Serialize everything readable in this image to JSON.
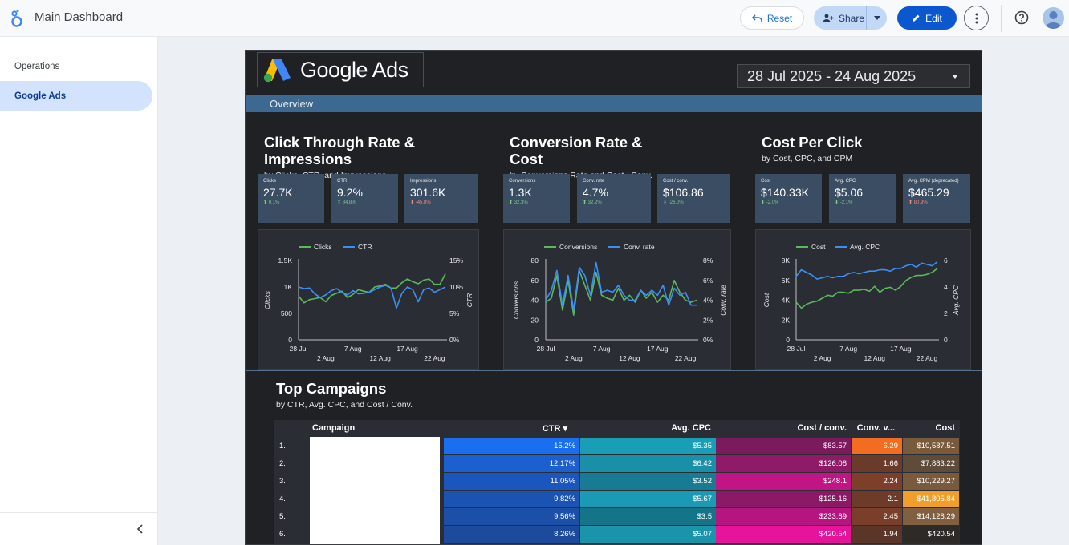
{
  "topbar": {
    "title": "Main Dashboard",
    "reset_label": "Reset",
    "share_label": "Share",
    "edit_label": "Edit"
  },
  "sidebar": {
    "items": [
      {
        "label": "Operations"
      },
      {
        "label": "Google Ads"
      }
    ],
    "active": "Google Ads"
  },
  "report": {
    "logo_text": "Google Ads",
    "date_range": "28 Jul 2025 - 24 Aug 2025",
    "overview_label": "Overview",
    "sections": [
      {
        "title_line1": "Click Through Rate &",
        "title_line2": "Impressions",
        "subtitle": "by Clicks, CTR, and Impressions"
      },
      {
        "title_line1": "Conversion Rate &",
        "title_line2": "Cost",
        "subtitle": "by Conversions Rate and Cost / Conv."
      },
      {
        "title_line1": "Cost Per Click",
        "title_line2": "",
        "subtitle": "by Cost, CPC, and CPM"
      }
    ],
    "kpis": [
      {
        "label": "Clicks",
        "value": "27.7K",
        "change": "⬆ 0.1%",
        "dir": "up"
      },
      {
        "label": "CTR",
        "value": "9.2%",
        "change": "⬆ 84.8%",
        "dir": "up"
      },
      {
        "label": "Impressions",
        "value": "301.6K",
        "change": "⬇ -45.8%",
        "dir": "down"
      },
      {
        "label": "Conversions",
        "value": "1.3K",
        "change": "⬆ 32.3%",
        "dir": "up"
      },
      {
        "label": "Conv. rate",
        "value": "4.7%",
        "change": "⬆ 32.2%",
        "dir": "up"
      },
      {
        "label": "Cost / conv.",
        "value": "$106.86",
        "change": "⬇ -26.0%",
        "dir": "up"
      },
      {
        "label": "Cost",
        "value": "$140.33K",
        "change": "⬇ -2.0%",
        "dir": "up"
      },
      {
        "label": "Avg. CPC",
        "value": "$5.06",
        "change": "⬇ -2.1%",
        "dir": "up"
      },
      {
        "label": "Avg. CPM (deprecated)",
        "value": "$465.29",
        "change": "⬆ 80.9%",
        "dir": "down"
      }
    ],
    "top_campaigns": {
      "title": "Top Campaigns",
      "subtitle": "by CTR, Avg. CPC, and Cost / Conv.",
      "columns": [
        "Campaign",
        "CTR ▾",
        "Avg. CPC",
        "Cost / conv.",
        "Conv. v...",
        "Cost"
      ],
      "rows": [
        {
          "idx": "1.",
          "ctr": "15.2%",
          "cpc": "$5.35",
          "cpa": "$83.57",
          "convv": "6.29",
          "cost": "$10,587.51"
        },
        {
          "idx": "2.",
          "ctr": "12.17%",
          "cpc": "$6.42",
          "cpa": "$126.08",
          "convv": "1.66",
          "cost": "$7,883.22"
        },
        {
          "idx": "3.",
          "ctr": "11.05%",
          "cpc": "$3.52",
          "cpa": "$248.1",
          "convv": "2.24",
          "cost": "$10,229.27"
        },
        {
          "idx": "4.",
          "ctr": "9.82%",
          "cpc": "$5.67",
          "cpa": "$125.16",
          "convv": "2.1",
          "cost": "$41,805.84"
        },
        {
          "idx": "5.",
          "ctr": "9.56%",
          "cpc": "$3.5",
          "cpa": "$233.69",
          "convv": "2.45",
          "cost": "$14,128.29"
        },
        {
          "idx": "6.",
          "ctr": "8.26%",
          "cpc": "$5.07",
          "cpa": "$420.54",
          "convv": "1.94",
          "cost": "$420.54"
        }
      ]
    }
  },
  "chart_data": [
    {
      "type": "line",
      "x": [
        "28 Jul",
        "29 Jul",
        "30 Jul",
        "31 Jul",
        "1 Aug",
        "2 Aug",
        "3 Aug",
        "4 Aug",
        "5 Aug",
        "6 Aug",
        "7 Aug",
        "8 Aug",
        "9 Aug",
        "10 Aug",
        "11 Aug",
        "12 Aug",
        "13 Aug",
        "14 Aug",
        "15 Aug",
        "16 Aug",
        "17 Aug",
        "18 Aug",
        "19 Aug",
        "20 Aug",
        "21 Aug",
        "22 Aug",
        "23 Aug",
        "24 Aug"
      ],
      "x_ticks_top": [
        "28 Jul",
        "7 Aug",
        "17 Aug"
      ],
      "x_ticks_bottom": [
        "2 Aug",
        "12 Aug",
        "22 Aug"
      ],
      "ylabel": "Clicks",
      "y2label": "CTR",
      "ylim": [
        0,
        1500
      ],
      "y_ticks": [
        "0",
        "500",
        "1K",
        "1.5K"
      ],
      "y2lim": [
        0,
        15
      ],
      "y2_ticks": [
        "0%",
        "5%",
        "10%",
        "15%"
      ],
      "series": [
        {
          "name": "Clicks",
          "axis": "left",
          "color": "#5cb85c",
          "values": [
            830,
            700,
            760,
            780,
            800,
            720,
            840,
            880,
            920,
            800,
            860,
            950,
            920,
            900,
            1000,
            1020,
            1050,
            980,
            980,
            1080,
            1150,
            1100,
            1060,
            1130,
            1150,
            1050,
            1050,
            1250
          ]
        },
        {
          "name": "CTR",
          "axis": "right",
          "color": "#3b8ff5",
          "values": [
            10.0,
            9.7,
            9.8,
            8.7,
            8.0,
            8.5,
            9.3,
            9.7,
            9.0,
            8.5,
            9.3,
            8.7,
            8.8,
            9.0,
            9.5,
            10.0,
            10.3,
            9.8,
            6.0,
            8.8,
            10.0,
            9.5,
            7.2,
            9.5,
            9.8,
            9.0,
            9.5,
            10.0
          ]
        }
      ]
    },
    {
      "type": "line",
      "x": [
        "28 Jul",
        "29 Jul",
        "30 Jul",
        "31 Jul",
        "1 Aug",
        "2 Aug",
        "3 Aug",
        "4 Aug",
        "5 Aug",
        "6 Aug",
        "7 Aug",
        "8 Aug",
        "9 Aug",
        "10 Aug",
        "11 Aug",
        "12 Aug",
        "13 Aug",
        "14 Aug",
        "15 Aug",
        "16 Aug",
        "17 Aug",
        "18 Aug",
        "19 Aug",
        "20 Aug",
        "21 Aug",
        "22 Aug",
        "23 Aug",
        "24 Aug"
      ],
      "x_ticks_top": [
        "28 Jul",
        "7 Aug",
        "17 Aug"
      ],
      "x_ticks_bottom": [
        "2 Aug",
        "12 Aug",
        "22 Aug"
      ],
      "ylabel": "Conversions",
      "y2label": "Conv. rate",
      "ylim": [
        0,
        80
      ],
      "y_ticks": [
        "0",
        "20",
        "40",
        "60",
        "80"
      ],
      "y2lim": [
        0,
        8
      ],
      "y2_ticks": [
        "0%",
        "2%",
        "4%",
        "6%",
        "8%"
      ],
      "series": [
        {
          "name": "Conversions",
          "axis": "left",
          "color": "#5cb85c",
          "values": [
            38,
            42,
            65,
            30,
            60,
            25,
            70,
            55,
            40,
            68,
            45,
            42,
            40,
            52,
            40,
            45,
            38,
            50,
            42,
            48,
            38,
            45,
            40,
            60,
            48,
            40,
            38,
            40
          ]
        },
        {
          "name": "Conv. rate",
          "axis": "right",
          "color": "#3b8ff5",
          "values": [
            4.0,
            5.0,
            7.0,
            3.5,
            6.5,
            3.0,
            7.3,
            6.5,
            4.5,
            7.8,
            4.8,
            5.0,
            4.8,
            5.5,
            4.5,
            4.0,
            4.0,
            5.0,
            4.5,
            5.0,
            4.5,
            5.5,
            3.5,
            5.2,
            4.5,
            4.8,
            3.5,
            3.5
          ]
        }
      ]
    },
    {
      "type": "line",
      "x": [
        "28 Jul",
        "29 Jul",
        "30 Jul",
        "31 Jul",
        "1 Aug",
        "2 Aug",
        "3 Aug",
        "4 Aug",
        "5 Aug",
        "6 Aug",
        "7 Aug",
        "8 Aug",
        "9 Aug",
        "10 Aug",
        "11 Aug",
        "12 Aug",
        "13 Aug",
        "14 Aug",
        "15 Aug",
        "16 Aug",
        "17 Aug",
        "18 Aug",
        "19 Aug",
        "20 Aug",
        "21 Aug",
        "22 Aug",
        "23 Aug",
        "24 Aug"
      ],
      "x_ticks_top": [
        "28 Jul",
        "7 Aug",
        "17 Aug"
      ],
      "x_ticks_bottom": [
        "2 Aug",
        "12 Aug",
        "22 Aug"
      ],
      "ylabel": "Cost",
      "y2label": "Avg. CPC",
      "ylim": [
        0,
        8000
      ],
      "y_ticks": [
        "0",
        "2K",
        "4K",
        "6K",
        "8K"
      ],
      "y2lim": [
        0,
        6
      ],
      "y2_ticks": [
        "0",
        "2",
        "4",
        "6"
      ],
      "series": [
        {
          "name": "Cost",
          "axis": "left",
          "color": "#5cb85c",
          "values": [
            3800,
            3200,
            3600,
            3800,
            3900,
            4200,
            4500,
            4400,
            4800,
            4800,
            4700,
            5000,
            5000,
            5100,
            4900,
            5400,
            4800,
            5200,
            5300,
            5000,
            5400,
            6000,
            6300,
            6500,
            6500,
            6600,
            6800,
            7200
          ]
        },
        {
          "name": "Avg. CPC",
          "axis": "right",
          "color": "#3b8ff5",
          "values": [
            4.8,
            5.3,
            5.1,
            4.9,
            4.6,
            4.7,
            4.8,
            4.7,
            4.8,
            4.8,
            5.0,
            5.1,
            5.0,
            5.1,
            5.2,
            5.2,
            5.3,
            5.3,
            5.2,
            5.4,
            5.4,
            5.6,
            5.7,
            5.5,
            5.8,
            5.7,
            5.6,
            5.9
          ]
        }
      ]
    }
  ],
  "colors": {
    "accent": "#0b57d0",
    "overview_bar": "#3c6991",
    "report_bg": "#202124"
  }
}
